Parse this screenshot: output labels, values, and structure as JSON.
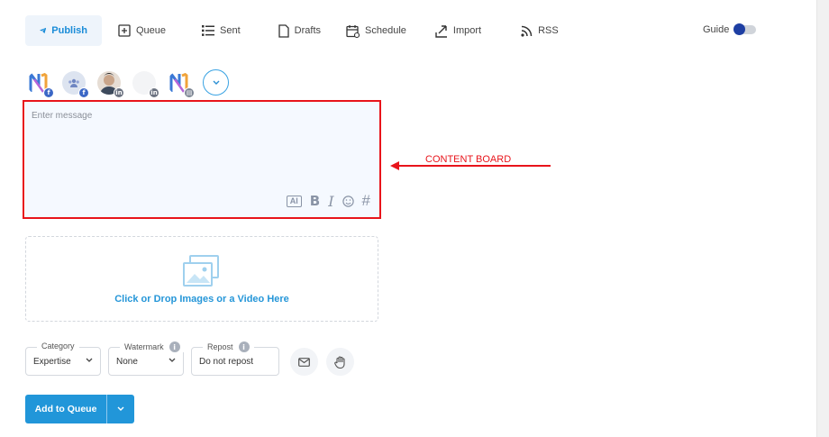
{
  "nav": {
    "publish": "Publish",
    "queue": "Queue",
    "sent": "Sent",
    "drafts": "Drafts",
    "schedule": "Schedule",
    "import": "Import",
    "rss": "RSS"
  },
  "guide": {
    "label": "Guide",
    "enabled": false
  },
  "accounts": [
    {
      "icon": "brand-logo-icon",
      "network": "facebook"
    },
    {
      "icon": "group-icon",
      "network": "facebook"
    },
    {
      "icon": "person-photo",
      "network": "linkedin"
    },
    {
      "icon": "blank-avatar",
      "network": "linkedin"
    },
    {
      "icon": "brand-logo-icon",
      "network": "google-business"
    }
  ],
  "composer": {
    "placeholder": "Enter message",
    "tools": {
      "ai": "AI",
      "bold": "B",
      "italic": "I",
      "hash": "#"
    }
  },
  "annotation": {
    "label": "CONTENT BOARD",
    "color": "#e8141b"
  },
  "media": {
    "text": "Click or Drop Images or a Video Here"
  },
  "options": {
    "category": {
      "label": "Category",
      "value": "Expertise"
    },
    "watermark": {
      "label": "Watermark",
      "value": "None"
    },
    "repost": {
      "label": "Repost",
      "value": "Do not repost"
    }
  },
  "actions": {
    "add_to_queue": "Add to Queue"
  },
  "colors": {
    "accent": "#2196d9",
    "board_bg": "#f5f9ff",
    "annotation": "#e8141b"
  }
}
